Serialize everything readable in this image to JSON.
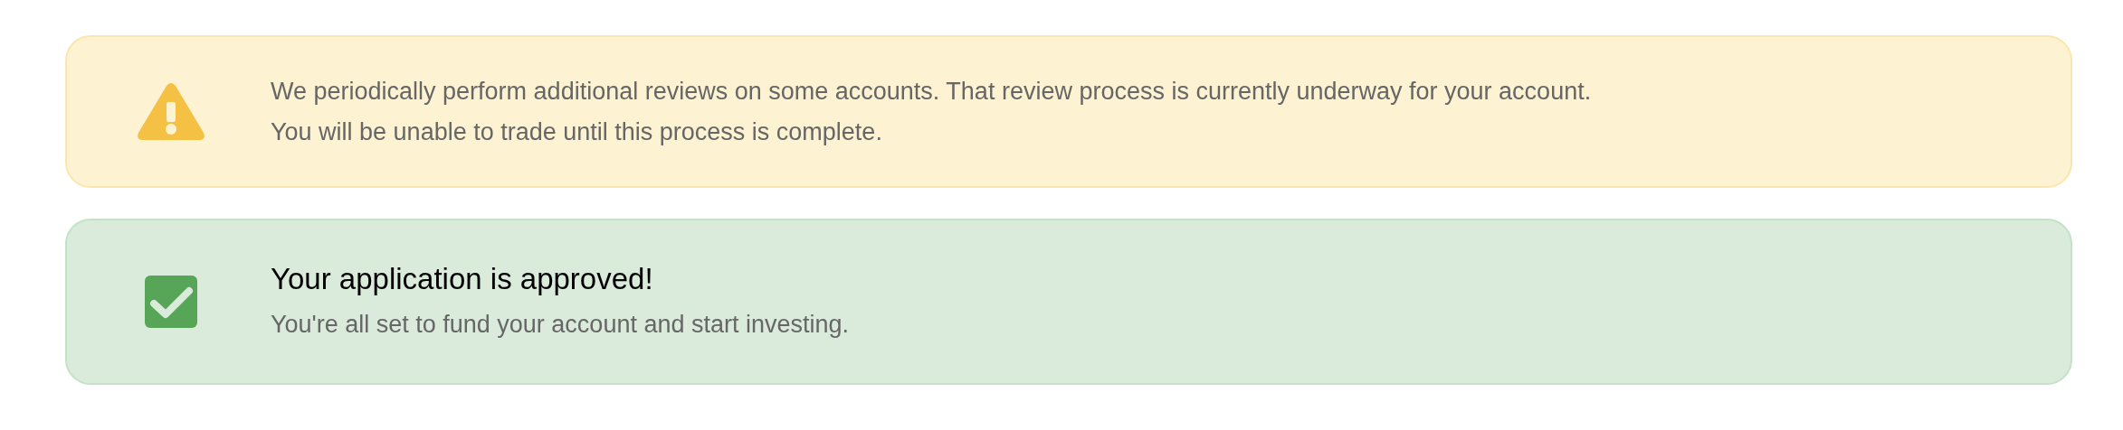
{
  "alerts": [
    {
      "kind": "warning",
      "lines": [
        "We periodically perform additional reviews on some accounts. That review process is currently underway for your account.",
        "You will be unable to trade until this process is complete."
      ]
    },
    {
      "kind": "success",
      "title": "Your application is approved!",
      "lines": [
        "You're all set to fund your account and start investing."
      ]
    }
  ]
}
